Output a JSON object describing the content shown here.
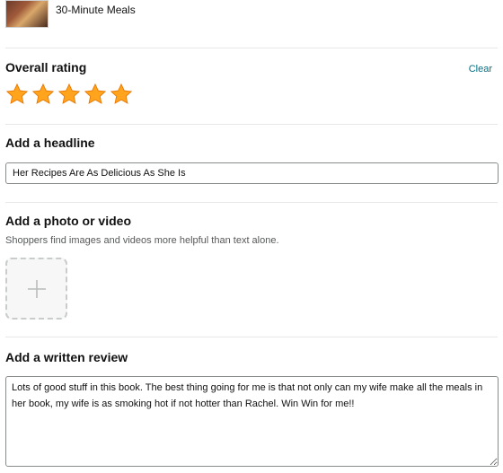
{
  "product": {
    "title": "30-Minute Meals"
  },
  "rating": {
    "heading": "Overall rating",
    "clear_label": "Clear",
    "value": 5,
    "max": 5,
    "star_color": "#FFA41C",
    "star_stroke": "#E77600"
  },
  "headline": {
    "heading": "Add a headline",
    "value": "Her Recipes Are As Delicious As She Is"
  },
  "media": {
    "heading": "Add a photo or video",
    "helper_text": "Shoppers find images and videos more helpful than text alone.",
    "upload_icon": "plus-icon"
  },
  "review": {
    "heading": "Add a written review",
    "value": "Lots of good stuff in this book. The best thing going for me is that not only can my wife make all the meals in her book, my wife is as smoking hot if not hotter than Rachel. Win Win for me!!"
  },
  "colors": {
    "link": "#007185",
    "divider": "#E7E7E7",
    "border": "#888C8C"
  }
}
